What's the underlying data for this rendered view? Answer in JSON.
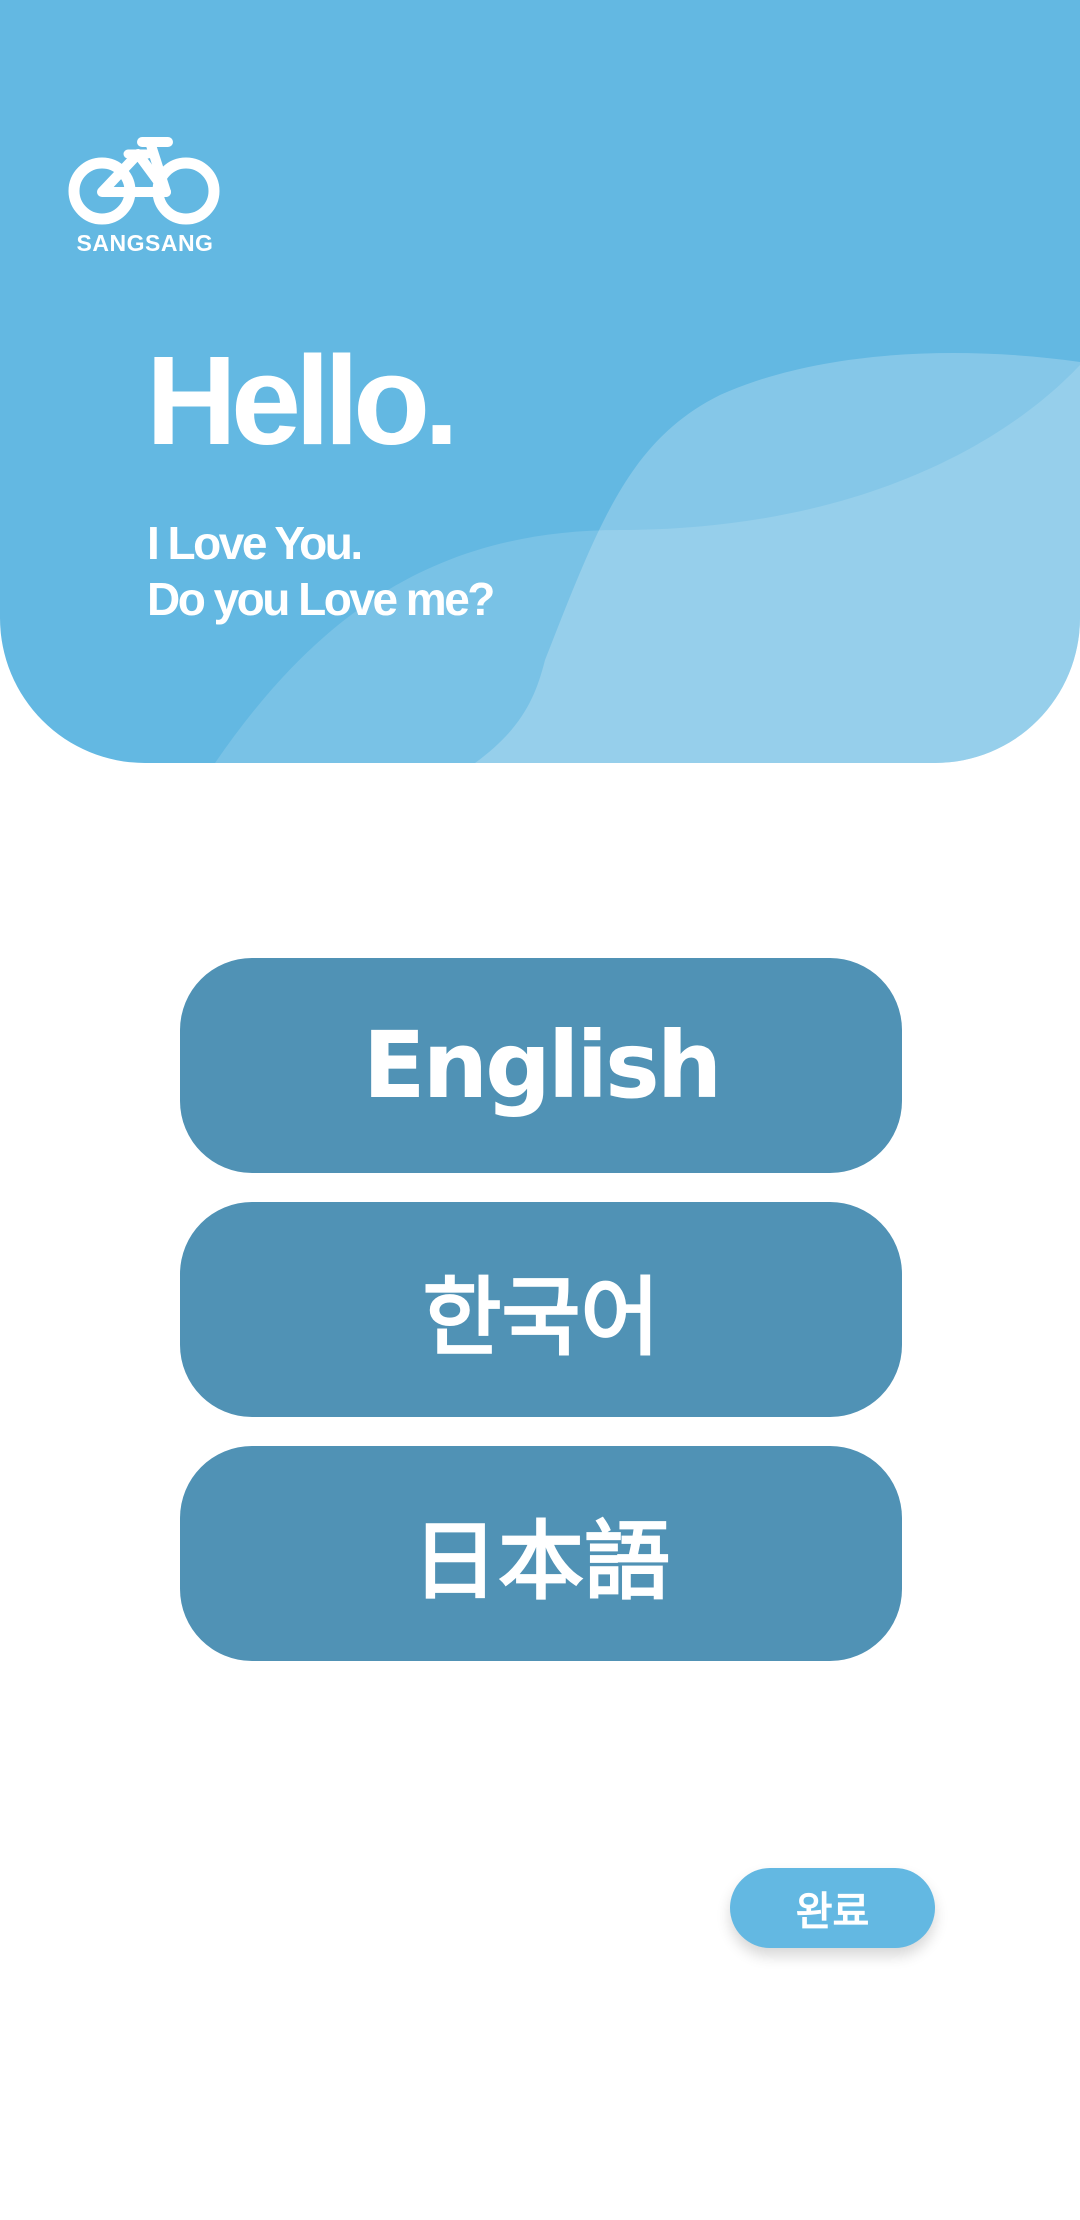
{
  "brand": {
    "name": "SANGSANG",
    "logo_icon": "bicycle-icon"
  },
  "hero": {
    "title": "Hello.",
    "subtitle_line1": "I Love You.",
    "subtitle_line2": "Do you Love me?"
  },
  "languages": [
    {
      "label": "English"
    },
    {
      "label": "한국어"
    },
    {
      "label": "日本語"
    }
  ],
  "actions": {
    "done_label": "완료"
  },
  "colors": {
    "primary": "#63b8e2",
    "button": "#5092b5",
    "text_on_color": "#ffffff",
    "background": "#ffffff"
  }
}
